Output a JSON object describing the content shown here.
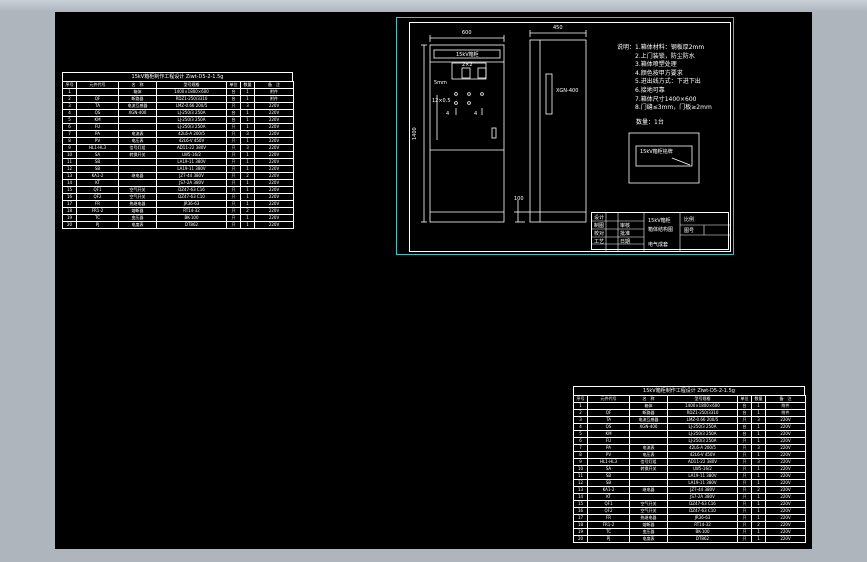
{
  "bom_title": "15kV箱柜制作工程设计 Ziwt-D5-2-1.5g",
  "bom_headers": [
    "序号",
    "元件代号",
    "名　称",
    "型号规格",
    "单位",
    "数量",
    "备　注"
  ],
  "bom_rows": [
    [
      "1",
      "",
      "箱体",
      "1400×1800×600",
      "台",
      "1",
      "附件"
    ],
    [
      "2",
      "QF",
      "断路器",
      "RDZ1-250/3310",
      "台",
      "1",
      "附件"
    ],
    [
      "3",
      "TA",
      "电流互感器",
      "LMZ-0.66 200/5",
      "只",
      "3",
      "220V"
    ],
    [
      "4",
      "QS",
      "XGN-400",
      "LJ-250/3 250A",
      "台",
      "1",
      "220V"
    ],
    [
      "5",
      "KM",
      "",
      "LJ-250/3 250A",
      "台",
      "1",
      "220V"
    ],
    [
      "6",
      "FU",
      "",
      "LJ-250/3 250A",
      "只",
      "1",
      "220V"
    ],
    [
      "7",
      "PA",
      "电流表",
      "42L6-A 200/5",
      "只",
      "3",
      "220V"
    ],
    [
      "8",
      "PV",
      "电压表",
      "42L6-V 450V",
      "只",
      "1",
      "220V"
    ],
    [
      "9",
      "HL1-HL3",
      "信号灯组",
      "AD11-22 380V",
      "只",
      "3",
      "220V"
    ],
    [
      "10",
      "SA",
      "转换开关",
      "LW5-16/2",
      "只",
      "1",
      "220V"
    ],
    [
      "11",
      "SB",
      "",
      "LA19-11 380V",
      "只",
      "1",
      "220V"
    ],
    [
      "12",
      "SB",
      "",
      "LA19-11 380V",
      "只",
      "1",
      "220V"
    ],
    [
      "13",
      "KA1-2",
      "继电器",
      "JZ7-44 380V",
      "只",
      "2",
      "220V"
    ],
    [
      "14",
      "KT",
      "",
      "JS7-2A 380V",
      "只",
      "1",
      "220V"
    ],
    [
      "15",
      "QF1",
      "空气开关",
      "DZ47-63 C16",
      "只",
      "1",
      "220V"
    ],
    [
      "16",
      "QF2",
      "空气开关",
      "DZ47-63 C10",
      "只",
      "1",
      "220V"
    ],
    [
      "17",
      "FR",
      "热继电器",
      "JR36-63",
      "只",
      "1",
      "220V"
    ],
    [
      "18",
      "FR1-2",
      "熔断器",
      "RT14-32",
      "只",
      "2",
      "220V"
    ],
    [
      "19",
      "TC",
      "变压器",
      "BK-100",
      "只",
      "1",
      "220V"
    ],
    [
      "20",
      "PJ",
      "电度表",
      "DT862",
      "只",
      "1",
      "220V"
    ]
  ],
  "dims": {
    "width_top": "600",
    "depth_top": "450",
    "height_left": "1400",
    "base_h": "100",
    "cabinet_label": "15kV箱柜",
    "side_label": "XGN-400",
    "lbl_2x2": "2×2",
    "lbl_5mm": "5mm",
    "lbl_12x": "12×0.5",
    "lbl_4a": "4",
    "lbl_4b": "4"
  },
  "notes": [
    "说明：1.箱体材料：钢板厚2mm",
    "　　　2.上门装锁，防尘防水",
    "　　　3.箱体喷塑处理",
    "　　　4.颜色按甲方要求",
    "　　　5.进出线方式：下进下出",
    "　　　6.接地可靠",
    "　　　7.箱体尺寸1400×600",
    "　　　8.门缝≤3mm，门板≥2mm"
  ],
  "weight_label": "数量：1台",
  "nameplate_label": "15kV箱柜铭牌",
  "title_block": {
    "project": "15kV箱柜",
    "drawing": "箱体结构图",
    "design": "设计",
    "check": "审核",
    "approve": "批准",
    "scale_label": "比例",
    "sheet_label": "图号",
    "company": "电气成套",
    "r1": "制图",
    "r2": "校对",
    "r3": "工艺",
    "r4": "日期"
  }
}
